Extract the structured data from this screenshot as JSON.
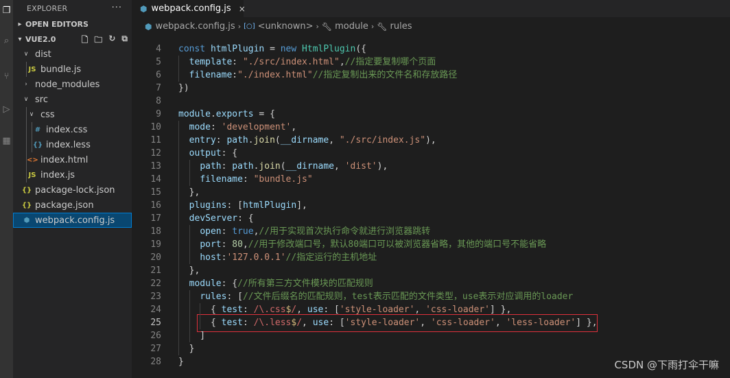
{
  "activity_icons": [
    "files-icon",
    "search-icon",
    "source-control-icon",
    "run-debug-icon",
    "extensions-icon"
  ],
  "sidebar": {
    "title": "EXPLORER",
    "more": "···",
    "open_editors": "OPEN EDITORS",
    "workspace": "VUE2.0",
    "tree": [
      {
        "label": "dist",
        "kind": "folder-open",
        "depth": 0,
        "icon": ""
      },
      {
        "label": "bundle.js",
        "kind": "file",
        "depth": 1,
        "icon": "JS",
        "icon_color": "#cbcb41"
      },
      {
        "label": "node_modules",
        "kind": "folder-closed",
        "depth": 0,
        "icon": ""
      },
      {
        "label": "src",
        "kind": "folder-open",
        "depth": 0,
        "icon": ""
      },
      {
        "label": "css",
        "kind": "folder-open",
        "depth": 1,
        "icon": ""
      },
      {
        "label": "index.css",
        "kind": "file",
        "depth": 2,
        "icon": "#",
        "icon_color": "#519aba"
      },
      {
        "label": "index.less",
        "kind": "file",
        "depth": 2,
        "icon": "{}",
        "icon_color": "#519aba"
      },
      {
        "label": "index.html",
        "kind": "file",
        "depth": 1,
        "icon": "<>",
        "icon_color": "#e37933"
      },
      {
        "label": "index.js",
        "kind": "file",
        "depth": 1,
        "icon": "JS",
        "icon_color": "#cbcb41"
      },
      {
        "label": "package-lock.json",
        "kind": "file",
        "depth": 0,
        "icon": "{}",
        "icon_color": "#cbcb41"
      },
      {
        "label": "package.json",
        "kind": "file",
        "depth": 0,
        "icon": "{}",
        "icon_color": "#cbcb41"
      },
      {
        "label": "webpack.config.js",
        "kind": "file",
        "depth": 0,
        "icon": "⬢",
        "icon_color": "#519aba",
        "selected": true
      }
    ]
  },
  "tab": {
    "label": "webpack.config.js",
    "close": "×"
  },
  "breadcrumb": [
    "webpack.config.js",
    "<unknown>",
    "module",
    "rules"
  ],
  "colors": {
    "accent": "#007fd4",
    "selection": "#094771",
    "highlight_box": "#e0313c"
  },
  "editor": {
    "current_line": 25,
    "lines": [
      {
        "n": "4",
        "indent": 0,
        "tokens": [
          [
            "kw",
            "const "
          ],
          [
            "var",
            "htmlPlugin"
          ],
          [
            "p",
            " = "
          ],
          [
            "kw",
            "new "
          ],
          [
            "cls",
            "HtmlPlugin"
          ],
          [
            "p",
            "({"
          ]
        ]
      },
      {
        "n": "5",
        "indent": 1,
        "tokens": [
          [
            "p",
            "  "
          ],
          [
            "var",
            "template"
          ],
          [
            "p",
            ": "
          ],
          [
            "str",
            "\"./src/index.html\""
          ],
          [
            "p",
            ","
          ],
          [
            "com",
            "//指定要复制哪个页面"
          ]
        ]
      },
      {
        "n": "6",
        "indent": 1,
        "tokens": [
          [
            "p",
            "  "
          ],
          [
            "var",
            "filename"
          ],
          [
            "p",
            ":"
          ],
          [
            "str",
            "\"./index.html\""
          ],
          [
            "com",
            "//指定复制出来的文件名和存放路径"
          ]
        ]
      },
      {
        "n": "7",
        "indent": 0,
        "tokens": [
          [
            "p",
            "})"
          ]
        ]
      },
      {
        "n": "8",
        "indent": 0,
        "tokens": []
      },
      {
        "n": "9",
        "indent": 0,
        "tokens": [
          [
            "var",
            "module"
          ],
          [
            "p",
            "."
          ],
          [
            "var",
            "exports"
          ],
          [
            "p",
            " = {"
          ]
        ]
      },
      {
        "n": "10",
        "indent": 1,
        "tokens": [
          [
            "p",
            "  "
          ],
          [
            "var",
            "mode"
          ],
          [
            "p",
            ": "
          ],
          [
            "str",
            "'development'"
          ],
          [
            "p",
            ","
          ]
        ]
      },
      {
        "n": "11",
        "indent": 1,
        "tokens": [
          [
            "p",
            "  "
          ],
          [
            "var",
            "entry"
          ],
          [
            "p",
            ": "
          ],
          [
            "var",
            "path"
          ],
          [
            "p",
            "."
          ],
          [
            "fn",
            "join"
          ],
          [
            "p",
            "("
          ],
          [
            "var",
            "__dirname"
          ],
          [
            "p",
            ", "
          ],
          [
            "str",
            "\"./src/index.js\""
          ],
          [
            "p",
            "),"
          ]
        ]
      },
      {
        "n": "12",
        "indent": 1,
        "tokens": [
          [
            "p",
            "  "
          ],
          [
            "var",
            "output"
          ],
          [
            "p",
            ": {"
          ]
        ]
      },
      {
        "n": "13",
        "indent": 2,
        "tokens": [
          [
            "p",
            "    "
          ],
          [
            "var",
            "path"
          ],
          [
            "p",
            ": "
          ],
          [
            "var",
            "path"
          ],
          [
            "p",
            "."
          ],
          [
            "fn",
            "join"
          ],
          [
            "p",
            "("
          ],
          [
            "var",
            "__dirname"
          ],
          [
            "p",
            ", "
          ],
          [
            "str",
            "'dist'"
          ],
          [
            "p",
            "),"
          ]
        ]
      },
      {
        "n": "14",
        "indent": 2,
        "tokens": [
          [
            "p",
            "    "
          ],
          [
            "var",
            "filename"
          ],
          [
            "p",
            ": "
          ],
          [
            "str",
            "\"bundle.js\""
          ]
        ]
      },
      {
        "n": "15",
        "indent": 1,
        "tokens": [
          [
            "p",
            "  },"
          ]
        ]
      },
      {
        "n": "16",
        "indent": 1,
        "tokens": [
          [
            "p",
            "  "
          ],
          [
            "var",
            "plugins"
          ],
          [
            "p",
            ": ["
          ],
          [
            "var",
            "htmlPlugin"
          ],
          [
            "p",
            "],"
          ]
        ]
      },
      {
        "n": "17",
        "indent": 1,
        "tokens": [
          [
            "p",
            "  "
          ],
          [
            "var",
            "devServer"
          ],
          [
            "p",
            ": {"
          ]
        ]
      },
      {
        "n": "18",
        "indent": 2,
        "tokens": [
          [
            "p",
            "    "
          ],
          [
            "var",
            "open"
          ],
          [
            "p",
            ": "
          ],
          [
            "kw",
            "true"
          ],
          [
            "p",
            ","
          ],
          [
            "com",
            "//用于实现首次执行命令就进行浏览器跳转"
          ]
        ]
      },
      {
        "n": "19",
        "indent": 2,
        "tokens": [
          [
            "p",
            "    "
          ],
          [
            "var",
            "port"
          ],
          [
            "p",
            ": "
          ],
          [
            "num",
            "80"
          ],
          [
            "p",
            ","
          ],
          [
            "com",
            "//用于修改端口号，默认80端口可以被浏览器省略，其他的端口号不能省略"
          ]
        ]
      },
      {
        "n": "20",
        "indent": 2,
        "tokens": [
          [
            "p",
            "    "
          ],
          [
            "var",
            "host"
          ],
          [
            "p",
            ":"
          ],
          [
            "str",
            "'127.0.0.1'"
          ],
          [
            "com",
            "//指定运行的主机地址"
          ]
        ]
      },
      {
        "n": "21",
        "indent": 1,
        "tokens": [
          [
            "p",
            "  },"
          ]
        ]
      },
      {
        "n": "22",
        "indent": 1,
        "tokens": [
          [
            "p",
            "  "
          ],
          [
            "var",
            "module"
          ],
          [
            "p",
            ": {"
          ],
          [
            "com",
            "//所有第三方文件模块的匹配规则"
          ]
        ]
      },
      {
        "n": "23",
        "indent": 2,
        "tokens": [
          [
            "p",
            "    "
          ],
          [
            "var",
            "rules"
          ],
          [
            "p",
            ": ["
          ],
          [
            "com",
            "//文件后缀名的匹配规则，test表示匹配的文件类型，use表示对应调用的loader"
          ]
        ]
      },
      {
        "n": "24",
        "indent": 3,
        "tokens": [
          [
            "p",
            "      { "
          ],
          [
            "var",
            "test"
          ],
          [
            "p",
            ": "
          ],
          [
            "rx",
            "/\\.css"
          ],
          [
            "rxo",
            "$"
          ],
          [
            "rx",
            "/"
          ],
          [
            "p",
            ", "
          ],
          [
            "var",
            "use"
          ],
          [
            "p",
            ": ["
          ],
          [
            "str",
            "'style-loader'"
          ],
          [
            "p",
            ", "
          ],
          [
            "str",
            "'css-loader'"
          ],
          [
            "p",
            "] },"
          ]
        ]
      },
      {
        "n": "25",
        "indent": 3,
        "tokens": [
          [
            "p",
            "      { "
          ],
          [
            "var",
            "test"
          ],
          [
            "p",
            ": "
          ],
          [
            "rx",
            "/\\.less"
          ],
          [
            "rxo",
            "$"
          ],
          [
            "rx",
            "/"
          ],
          [
            "p",
            ", "
          ],
          [
            "var",
            "use"
          ],
          [
            "p",
            ": ["
          ],
          [
            "str",
            "'style-loader'"
          ],
          [
            "p",
            ", "
          ],
          [
            "str",
            "'css-loader'"
          ],
          [
            "p",
            ", "
          ],
          [
            "str",
            "'less-loader'"
          ],
          [
            "p",
            "] },"
          ]
        ]
      },
      {
        "n": "26",
        "indent": 2,
        "tokens": [
          [
            "p",
            "    ]"
          ]
        ]
      },
      {
        "n": "27",
        "indent": 1,
        "tokens": [
          [
            "p",
            "  }"
          ]
        ]
      },
      {
        "n": "28",
        "indent": 0,
        "tokens": [
          [
            "p",
            "}"
          ]
        ]
      }
    ]
  },
  "watermark": "CSDN @下雨打伞干嘛"
}
